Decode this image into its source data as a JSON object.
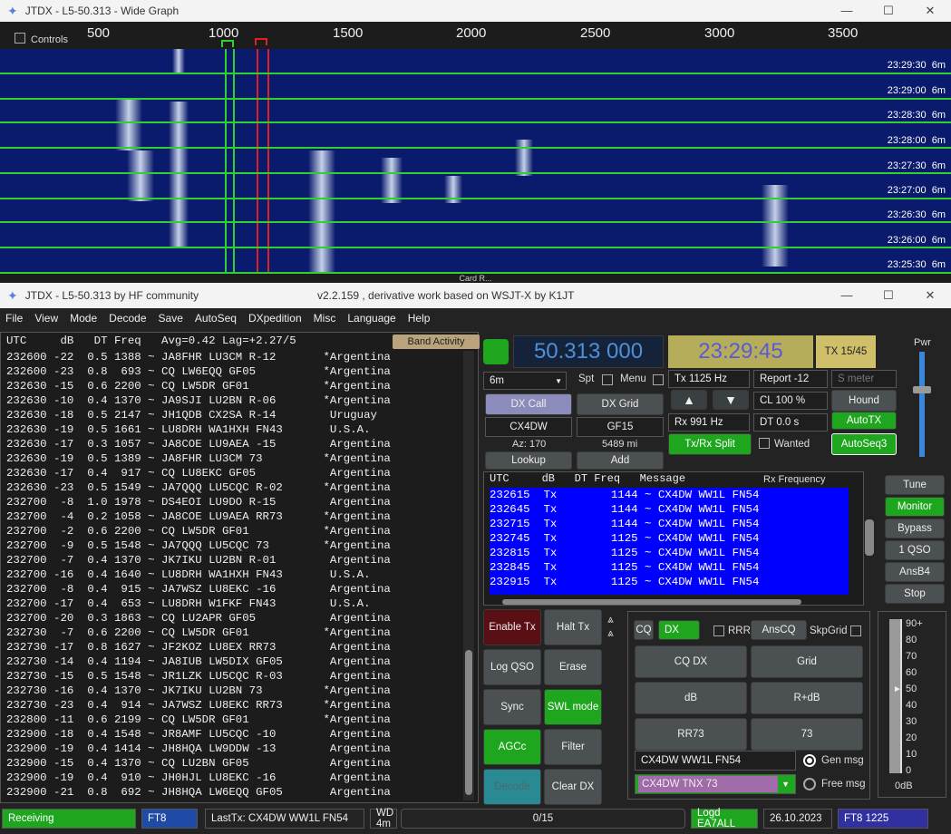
{
  "wide_graph": {
    "title": "JTDX - L5-50.313 - Wide Graph",
    "controls_label": "Controls",
    "scale_ticks": [
      "500",
      "1000",
      "1500",
      "2000",
      "2500",
      "3000",
      "3500"
    ],
    "timestamps": [
      {
        "time": "23:29:30",
        "band": "6m"
      },
      {
        "time": "23:29:00",
        "band": "6m"
      },
      {
        "time": "23:28:30",
        "band": "6m"
      },
      {
        "time": "23:28:00",
        "band": "6m"
      },
      {
        "time": "23:27:30",
        "band": "6m"
      },
      {
        "time": "23:27:00",
        "band": "6m"
      },
      {
        "time": "23:26:30",
        "band": "6m"
      },
      {
        "time": "23:26:00",
        "band": "6m"
      },
      {
        "time": "23:25:30",
        "band": "6m"
      }
    ],
    "status_text": "Card R..."
  },
  "main": {
    "title_left": "JTDX - L5-50.313  by HF community",
    "title_center": "v2.2.159 , derivative work based on WSJT-X by K1JT",
    "menu": [
      "File",
      "View",
      "Mode",
      "Decode",
      "Save",
      "AutoSeq",
      "DXpedition",
      "Misc",
      "Language",
      "Help"
    ],
    "band_header": "UTC     dB   DT Freq   Avg=0.42 Lag=+2.27/5",
    "band_activity_label": "Band Activity",
    "band_rows": [
      "232600 -22  0.5 1388 ~ JA8FHR LU3CM R-12       *Argentina",
      "232600 -23  0.8  693 ~ CQ LW6EQQ GF05          *Argentina",
      "232630 -15  0.6 2200 ~ CQ LW5DR GF01           *Argentina",
      "232630 -10  0.4 1370 ~ JA9SJI LU2BN R-06       *Argentina",
      "232630 -18  0.5 2147 ~ JH1QDB CX2SA R-14        Uruguay",
      "232630 -19  0.5 1661 ~ LU8DRH WA1HXH FN43       U.S.A.",
      "232630 -17  0.3 1057 ~ JA8COE LU9AEA -15        Argentina",
      "232630 -19  0.5 1389 ~ JA8FHR LU3CM 73         *Argentina",
      "232630 -17  0.4  917 ~ CQ LU8EKC GF05           Argentina",
      "232630 -23  0.5 1549 ~ JA7QQQ LU5CQC R-02      *Argentina",
      "232700  -8  1.0 1978 ~ DS4EOI LU9DO R-15        Argentina",
      "232700  -4  0.2 1058 ~ JA8COE LU9AEA RR73      *Argentina",
      "232700  -2  0.6 2200 ~ CQ LW5DR GF01           *Argentina",
      "232700  -9  0.5 1548 ~ JA7QQQ LU5CQC 73        *Argentina",
      "232700  -7  0.4 1370 ~ JK7IKU LU2BN R-01        Argentina",
      "232700 -16  0.4 1640 ~ LU8DRH WA1HXH FN43       U.S.A.",
      "232700  -8  0.4  915 ~ JA7WSZ LU8EKC -16        Argentina",
      "232700 -17  0.4  653 ~ LU8DRH W1FKF FN43        U.S.A.",
      "232700 -20  0.3 1863 ~ CQ LU2APR GF05           Argentina",
      "232730  -7  0.6 2200 ~ CQ LW5DR GF01           *Argentina",
      "232730 -17  0.8 1627 ~ JF2KOZ LU8EX RR73        Argentina",
      "232730 -14  0.4 1194 ~ JA8IUB LW5DIX GF05       Argentina",
      "232730 -15  0.5 1548 ~ JR1LZK LU5CQC R-03       Argentina",
      "232730 -16  0.4 1370 ~ JK7IKU LU2BN 73         *Argentina",
      "232730 -23  0.4  914 ~ JA7WSZ LU8EKC RR73      *Argentina",
      "232800 -11  0.6 2199 ~ CQ LW5DR GF01           *Argentina",
      "232900 -18  0.4 1548 ~ JR8AMF LU5CQC -10        Argentina",
      "232900 -19  0.4 1414 ~ JH8HQA LW9DDW -13        Argentina",
      "232900 -15  0.4 1370 ~ CQ LU2BN GF05            Argentina",
      "232900 -19  0.4  910 ~ JH0HJL LU8EKC -16        Argentina",
      "232900 -21  0.8  692 ~ JH8HQA LW6EQQ GF05       Argentina"
    ],
    "dial_freq": "50.313 000",
    "utc_clock": "23:29:45",
    "tx_period": "TX 15/45",
    "pwr_label": "Pwr",
    "band_select": "6m",
    "spt_label": "Spt",
    "menu_label": "Menu",
    "tx_freq": "Tx  1125  Hz",
    "report": "Report -12",
    "smeter_placeholder": "S meter",
    "dx_call_label": "DX Call",
    "dx_grid_label": "DX Grid",
    "dx_call": "CX4DW",
    "dx_grid": "GF15",
    "az": "Az: 170",
    "dist": "5489 mi",
    "lookup_label": "Lookup",
    "add_label": "Add",
    "up_arrow": "▲",
    "down_arrow": "▼",
    "cl": "CL  100 %",
    "hound_label": "Hound",
    "rx_freq": "Rx  991  Hz",
    "dt": "DT 0.0 s",
    "autotx_label": "AutoTX",
    "txrx_split_label": "Tx/Rx Split",
    "wanted_label": "Wanted",
    "autoseq3_label": "AutoSeq3",
    "rx_header": "UTC     dB   DT Freq   Message",
    "rx_freq_label": "Rx Frequency",
    "rx_rows": [
      "232615  Tx        1144 ~ CX4DW WW1L FN54",
      "232645  Tx        1144 ~ CX4DW WW1L FN54",
      "232715  Tx        1144 ~ CX4DW WW1L FN54",
      "232745  Tx        1125 ~ CX4DW WW1L FN54",
      "232815  Tx        1125 ~ CX4DW WW1L FN54",
      "232845  Tx        1125 ~ CX4DW WW1L FN54",
      "232915  Tx        1125 ~ CX4DW WW1L FN54"
    ],
    "side_buttons": [
      "Tune",
      "Monitor",
      "Bypass",
      "1 QSO",
      "AnsB4",
      "Stop"
    ],
    "ctrl_buttons": {
      "enable_tx": "Enable Tx",
      "halt_tx": "Halt Tx",
      "log_qso": "Log QSO",
      "erase": "Erase",
      "sync": "Sync",
      "swl_mode": "SWL mode",
      "agcc": "AGCc",
      "filter": "Filter",
      "decode": "Decode",
      "clear_dx": "Clear DX"
    },
    "cq_label": "CQ",
    "dx_label": "DX",
    "rrr_label": "RRR",
    "anscq_label": "AnsCQ",
    "skpgrid_label": "SkpGrid",
    "msg_buttons": [
      "CQ DX",
      "Grid",
      "dB",
      "R+dB",
      "RR73",
      "73"
    ],
    "gen_text": "CX4DW WW1L FN54",
    "free_text": "CX4DW TNX 73",
    "gen_msg_label": "Gen msg",
    "free_msg_label": "Free msg",
    "meter_ticks": [
      "90+",
      "80",
      "70",
      "60",
      "50",
      "40",
      "30",
      "20",
      "10",
      "0"
    ],
    "meter_unit": "0dB",
    "status": {
      "receiving": "Receiving",
      "mode": "FT8",
      "lasttx": "LastTx: CX4DW WW1L FN54",
      "wd": "WD 4m",
      "progress": "0/15",
      "progress_fraction": 0.0,
      "logd": "Logd EA7ALL",
      "date": "26.10.2023",
      "mode_freq": "FT8  1225"
    }
  },
  "colors": {
    "accent_green": "#1fa61f",
    "rx_blue": "#0000ff",
    "waterfall": "#0a1a6c"
  }
}
